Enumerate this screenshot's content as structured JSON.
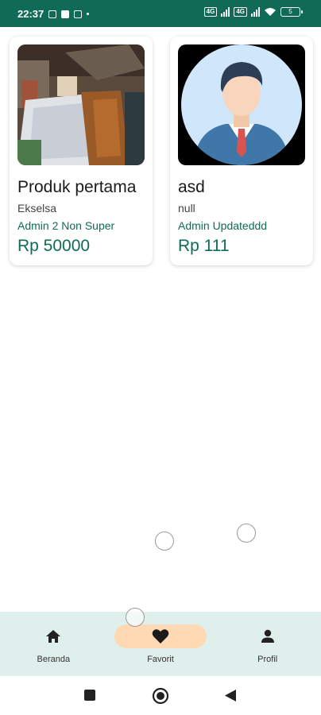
{
  "status_bar": {
    "time": "22:37",
    "sim1": "4G",
    "sim2": "4G",
    "battery": "5"
  },
  "products": [
    {
      "name": "Produk pertama",
      "category": "Ekselsa",
      "seller": "Admin 2 Non Super",
      "price": "Rp 50000",
      "image": "coffee-product-photo"
    },
    {
      "name": "asd",
      "category": "null",
      "seller": "Admin Updateddd",
      "price": "Rp 111",
      "image": "businessman-avatar"
    }
  ],
  "bottom_nav": {
    "items": [
      {
        "label": "Beranda",
        "icon": "home-icon",
        "active": false
      },
      {
        "label": "Favorit",
        "icon": "heart-icon",
        "active": true
      },
      {
        "label": "Profil",
        "icon": "person-icon",
        "active": false
      }
    ]
  },
  "system_nav": {
    "buttons": [
      "recents-button",
      "home-button",
      "back-button"
    ]
  },
  "colors": {
    "primary": "#0f6b55",
    "nav_background": "#dff0ec",
    "active_pill": "#ffd9b3"
  }
}
